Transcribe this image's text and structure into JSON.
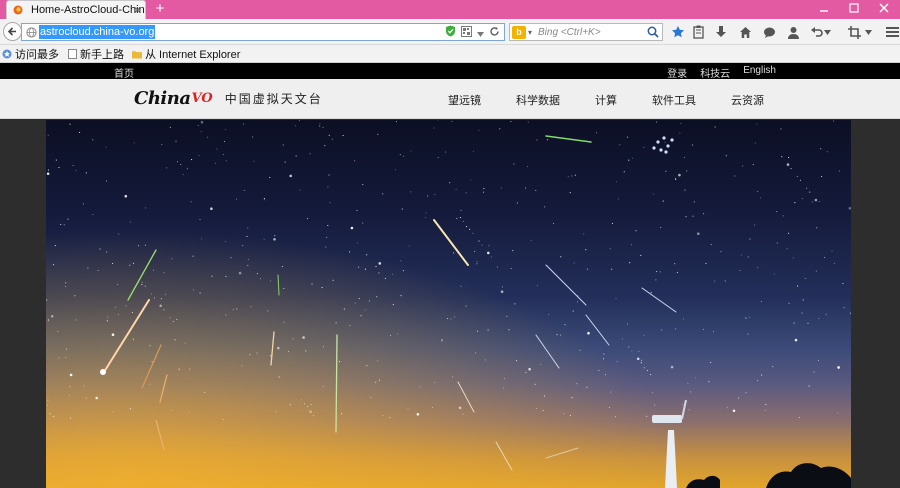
{
  "browser": {
    "tab_title": "Home-AstroCloud-ChinaVO",
    "tab_close": "×",
    "new_tab": "+",
    "url": "astrocloud.china-vo.org",
    "search_placeholder": "Bing  <Ctrl+K>",
    "search_engine": "b"
  },
  "bookmarks": [
    {
      "label": "访问最多",
      "icon": "bookmark-star-icon"
    },
    {
      "label": "新手上路",
      "icon": "page-icon"
    },
    {
      "label": "从 Internet Explorer",
      "icon": "folder-icon"
    }
  ],
  "site": {
    "top_home": "首页",
    "top_right": [
      "登录",
      "科技云",
      "English"
    ],
    "logo_main": "China",
    "logo_vo": "VO",
    "logo_cn": "中国虚拟天文台",
    "nav": [
      "望远镜",
      "科学数据",
      "计算",
      "软件工具",
      "云资源"
    ]
  },
  "colors": {
    "titlebar": "#e35aa2",
    "url_highlight": "#3399ff",
    "accent_red": "#d22222"
  }
}
